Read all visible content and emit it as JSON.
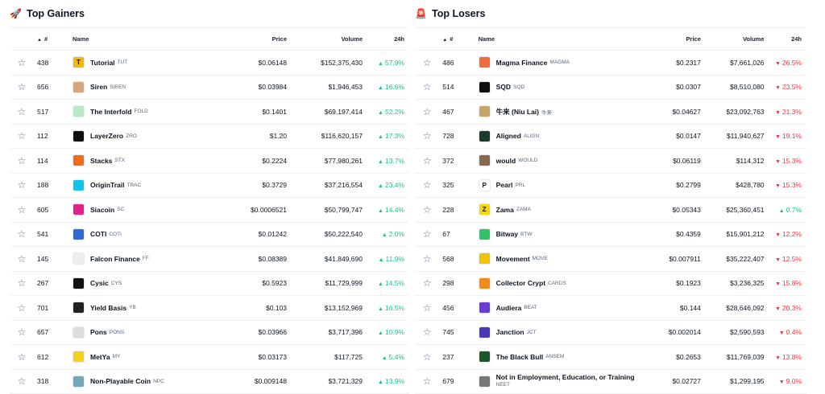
{
  "gainers": {
    "title": "Top Gainers",
    "icon": "rocket-icon",
    "headers": {
      "rank": "#",
      "name": "Name",
      "price": "Price",
      "volume": "Volume",
      "change": "24h"
    },
    "rows": [
      {
        "rank": "438",
        "name": "Tutorial",
        "symbol": "TUT",
        "price": "$0.06148",
        "volume": "$152,375,430",
        "change": "57.9%",
        "dir": "up",
        "logo_color": "#f0b90b",
        "logo_text": "T"
      },
      {
        "rank": "656",
        "name": "Siren",
        "symbol": "SIREN",
        "price": "$0.03984",
        "volume": "$1,946,453",
        "change": "16.6%",
        "dir": "up",
        "logo_color": "#d8a47a",
        "logo_text": ""
      },
      {
        "rank": "517",
        "name": "The Interfold",
        "symbol": "FOLD",
        "price": "$0.1401",
        "volume": "$69,197,414",
        "change": "52.2%",
        "dir": "up",
        "logo_color": "#b9e8c8",
        "logo_text": ""
      },
      {
        "rank": "112",
        "name": "LayerZero",
        "symbol": "ZRO",
        "price": "$1.20",
        "volume": "$116,620,157",
        "change": "17.3%",
        "dir": "up",
        "logo_color": "#111111",
        "logo_text": ""
      },
      {
        "rank": "114",
        "name": "Stacks",
        "symbol": "STX",
        "price": "$0.2224",
        "volume": "$77,980,261",
        "change": "13.7%",
        "dir": "up",
        "logo_color": "#f26b1d",
        "logo_text": ""
      },
      {
        "rank": "188",
        "name": "OriginTrail",
        "symbol": "TRAC",
        "price": "$0.3729",
        "volume": "$37,216,554",
        "change": "23.4%",
        "dir": "up",
        "logo_color": "#11c5e8",
        "logo_text": ""
      },
      {
        "rank": "605",
        "name": "Siacoin",
        "symbol": "SC",
        "price": "$0.0006521",
        "volume": "$50,799,747",
        "change": "14.4%",
        "dir": "up",
        "logo_color": "#e2228a",
        "logo_text": ""
      },
      {
        "rank": "541",
        "name": "COTI",
        "symbol": "COTI",
        "price": "$0.01242",
        "volume": "$50,222,540",
        "change": "2.0%",
        "dir": "up",
        "logo_color": "#2c6bd6",
        "logo_text": ""
      },
      {
        "rank": "145",
        "name": "Falcon Finance",
        "symbol": "FF",
        "price": "$0.08389",
        "volume": "$41,849,690",
        "change": "11.9%",
        "dir": "up",
        "logo_color": "#eeeeee",
        "logo_text": ""
      },
      {
        "rank": "267",
        "name": "Cysic",
        "symbol": "CYS",
        "price": "$0.5923",
        "volume": "$11,729,999",
        "change": "14.5%",
        "dir": "up",
        "logo_color": "#111111",
        "logo_text": ""
      },
      {
        "rank": "701",
        "name": "Yield Basis",
        "symbol": "YB",
        "price": "$0.103",
        "volume": "$13,152,969",
        "change": "16.5%",
        "dir": "up",
        "logo_color": "#222222",
        "logo_text": ""
      },
      {
        "rank": "657",
        "name": "Pons",
        "symbol": "PONS",
        "price": "$0.03966",
        "volume": "$3,717,396",
        "change": "10.9%",
        "dir": "up",
        "logo_color": "#dddddd",
        "logo_text": ""
      },
      {
        "rank": "612",
        "name": "MetYa",
        "symbol": "MY",
        "price": "$0.03173",
        "volume": "$117,725",
        "change": "5.4%",
        "dir": "up",
        "logo_color": "#f2d21b",
        "logo_text": ""
      },
      {
        "rank": "318",
        "name": "Non-Playable Coin",
        "symbol": "NPC",
        "price": "$0.009148",
        "volume": "$3,721,329",
        "change": "13.9%",
        "dir": "up",
        "logo_color": "#6fa8b8",
        "logo_text": ""
      }
    ]
  },
  "losers": {
    "title": "Top Losers",
    "icon": "alarm-icon",
    "headers": {
      "rank": "#",
      "name": "Name",
      "price": "Price",
      "volume": "Volume",
      "change": "24h"
    },
    "rows": [
      {
        "rank": "486",
        "name": "Magma Finance",
        "symbol": "MAGMA",
        "price": "$0.2317",
        "volume": "$7,661,026",
        "change": "26.5%",
        "dir": "down",
        "logo_color": "#f26b3a",
        "logo_text": ""
      },
      {
        "rank": "514",
        "name": "SQD",
        "symbol": "SQD",
        "price": "$0.0307",
        "volume": "$8,510,080",
        "change": "23.5%",
        "dir": "down",
        "logo_color": "#111111",
        "logo_text": ""
      },
      {
        "rank": "467",
        "name": "牛来 (Niu Lai)",
        "symbol": "牛来",
        "price": "$0.04627",
        "volume": "$23,092,763",
        "change": "21.3%",
        "dir": "down",
        "logo_color": "#c8a46a",
        "logo_text": ""
      },
      {
        "rank": "728",
        "name": "Aligned",
        "symbol": "ALIGN",
        "price": "$0.0147",
        "volume": "$11,940,627",
        "change": "19.1%",
        "dir": "down",
        "logo_color": "#1a3a2a",
        "logo_text": ""
      },
      {
        "rank": "372",
        "name": "would",
        "symbol": "WOULD",
        "price": "$0.06119",
        "volume": "$114,312",
        "change": "15.3%",
        "dir": "down",
        "logo_color": "#8a6a4a",
        "logo_text": ""
      },
      {
        "rank": "325",
        "name": "Pearl",
        "symbol": "PRL",
        "price": "$0.2799",
        "volume": "$428,780",
        "change": "15.3%",
        "dir": "down",
        "logo_color": "#ffffff",
        "logo_text": "P"
      },
      {
        "rank": "228",
        "name": "Zama",
        "symbol": "ZAMA",
        "price": "$0.05343",
        "volume": "$25,360,451",
        "change": "0.7%",
        "dir": "up",
        "logo_color": "#f5d800",
        "logo_text": "Z"
      },
      {
        "rank": "67",
        "name": "Bitway",
        "symbol": "BTW",
        "price": "$0.4359",
        "volume": "$15,901,212",
        "change": "12.2%",
        "dir": "down",
        "logo_color": "#33c26a",
        "logo_text": ""
      },
      {
        "rank": "568",
        "name": "Movement",
        "symbol": "MOVE",
        "price": "$0.007911",
        "volume": "$35,222,407",
        "change": "12.5%",
        "dir": "down",
        "logo_color": "#f2c400",
        "logo_text": ""
      },
      {
        "rank": "298",
        "name": "Collector Crypt",
        "symbol": "CARDS",
        "price": "$0.1923",
        "volume": "$3,236,325",
        "change": "15.8%",
        "dir": "down",
        "logo_color": "#f28a1a",
        "logo_text": ""
      },
      {
        "rank": "456",
        "name": "Audiera",
        "symbol": "BEAT",
        "price": "$0.144",
        "volume": "$28,646,092",
        "change": "20.3%",
        "dir": "down",
        "logo_color": "#6a3cd6",
        "logo_text": ""
      },
      {
        "rank": "745",
        "name": "Janction",
        "symbol": "JCT",
        "price": "$0.002014",
        "volume": "$2,590,593",
        "change": "0.4%",
        "dir": "down",
        "logo_color": "#4a3ab8",
        "logo_text": ""
      },
      {
        "rank": "237",
        "name": "The Black Bull",
        "symbol": "ANSEM",
        "price": "$0.2653",
        "volume": "$11,769,039",
        "change": "13.8%",
        "dir": "down",
        "logo_color": "#1a5a2a",
        "logo_text": ""
      },
      {
        "rank": "679",
        "name": "Not in Employment, Education, or Training",
        "symbol": "NEET",
        "price": "$0.02727",
        "volume": "$1,299,195",
        "change": "9.0%",
        "dir": "down",
        "logo_color": "#777777",
        "logo_text": ""
      }
    ]
  }
}
